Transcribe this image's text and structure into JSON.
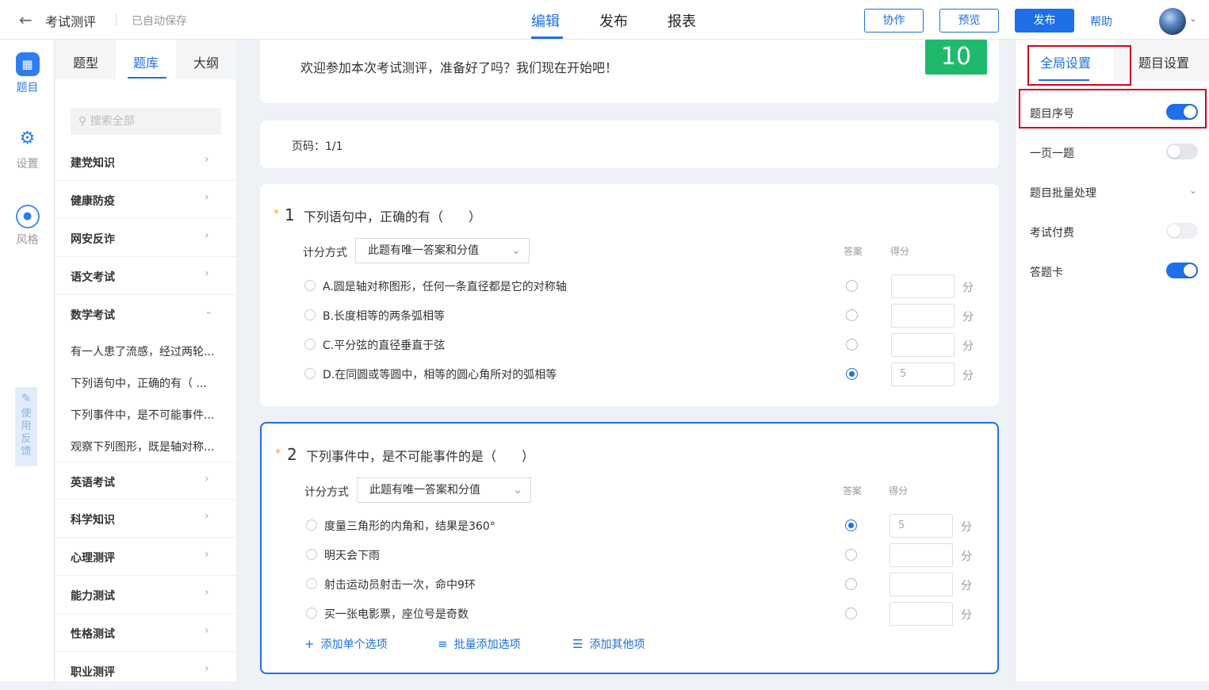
{
  "header": {
    "title": "考试测评",
    "saved": "已自动保存",
    "tabs": [
      "编辑",
      "发布",
      "报表"
    ],
    "buttons": {
      "collab": "协作",
      "preview": "预览",
      "publish": "发布"
    },
    "help": "帮助"
  },
  "rail": {
    "items": [
      {
        "label": "题目",
        "icon": "grid-icon"
      },
      {
        "label": "设置",
        "icon": "gear-icon"
      },
      {
        "label": "风格",
        "icon": "palette-icon"
      }
    ],
    "feedback": "使用反馈"
  },
  "panel": {
    "tabs": [
      "题型",
      "题库",
      "大纲"
    ],
    "search_placeholder": "搜索全部",
    "categories": [
      "建党知识",
      "健康防疫",
      "网安反诈",
      "语文考试",
      "数学考试"
    ],
    "sub_items": [
      "有一人患了流感，经过两轮...",
      "下列语句中，正确的有（ ...",
      "下列事件中，是不可能事件...",
      "观察下列图形，既是轴对称..."
    ],
    "categories_after": [
      "英语考试",
      "科学知识",
      "心理测评",
      "能力测试",
      "性格测试",
      "职业测评"
    ]
  },
  "main": {
    "welcome": "欢迎参加本次考试测评，准备好了吗？我们现在开始吧！",
    "timer": "10",
    "page_label": "页码：1/1",
    "scoring_label": "计分方式",
    "scoring_value": "此题有唯一答案和分值",
    "answer_col": "答案",
    "score_col": "得分",
    "unit": "分",
    "questions": [
      {
        "num": "1",
        "text": "下列语句中，正确的有（　　）",
        "options": [
          {
            "text": "A.圆是轴对称图形，任何一条直径都是它的对称轴",
            "correct": false,
            "score": ""
          },
          {
            "text": "B.长度相等的两条弧相等",
            "correct": false,
            "score": ""
          },
          {
            "text": "C.平分弦的直径垂直于弦",
            "correct": false,
            "score": ""
          },
          {
            "text": "D.在同圆或等圆中，相等的圆心角所对的弧相等",
            "correct": true,
            "score": "5"
          }
        ]
      },
      {
        "num": "2",
        "text": "下列事件中，是不可能事件的是（　　）",
        "options": [
          {
            "text": "度量三角形的内角和，结果是360°",
            "correct": true,
            "score": "5"
          },
          {
            "text": "明天会下雨",
            "correct": false,
            "score": ""
          },
          {
            "text": "射击运动员射击一次，命中9环",
            "correct": false,
            "score": ""
          },
          {
            "text": "买一张电影票，座位号是奇数",
            "correct": false,
            "score": ""
          }
        ]
      }
    ],
    "actions": [
      "添加单个选项",
      "批量添加选项",
      "添加其他项"
    ]
  },
  "right": {
    "tabs": [
      "全局设置",
      "题目设置"
    ],
    "settings": [
      {
        "label": "题目序号",
        "type": "toggle",
        "on": true
      },
      {
        "label": "一页一题",
        "type": "toggle",
        "on": false
      },
      {
        "label": "题目批量处理",
        "type": "expand"
      },
      {
        "label": "考试付费",
        "type": "toggle",
        "on": false
      },
      {
        "label": "答题卡",
        "type": "toggle",
        "on": true
      }
    ]
  }
}
